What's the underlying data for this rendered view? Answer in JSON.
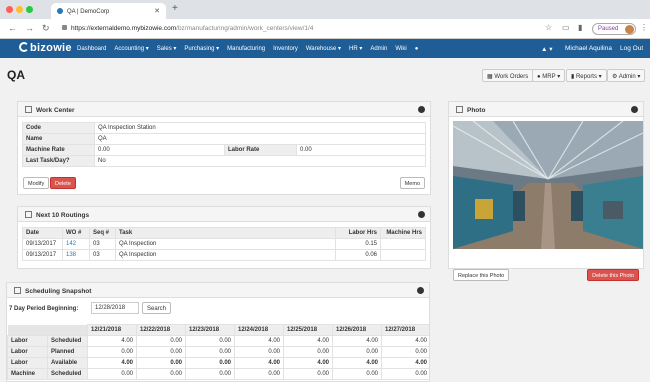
{
  "browser": {
    "tab_title": "QA | DemoCorp",
    "url_host": "https://externaldemo.mybizowie.com",
    "url_path": "/bz/manufacturing/admin/work_centers/view/1/4",
    "paused": "Paused"
  },
  "nav": {
    "logo": "bizowie",
    "items": [
      "Dashboard",
      "Accounting ▾",
      "Sales ▾",
      "Purchasing ▾",
      "Manufacturing",
      "Inventory",
      "Warehouse ▾",
      "HR ▾",
      "Admin",
      "Wiki"
    ],
    "user": "Michael Aquilina",
    "logout": "Log Out"
  },
  "page": {
    "title": "QA",
    "buttons": [
      "Work Orders",
      "MRP ▾",
      "Reports ▾",
      "Admin ▾"
    ]
  },
  "work_center": {
    "title": "Work Center",
    "code_label": "Code",
    "code": "QA Inspection Station",
    "name_label": "Name",
    "name": "QA",
    "machine_rate_label": "Machine Rate",
    "machine_rate": "0.00",
    "labor_rate_label": "Labor Rate",
    "labor_rate": "0.00",
    "last_task_label": "Last Task/Day?",
    "last_task": "No",
    "modify": "Modify",
    "delete": "Delete",
    "memo": "Memo"
  },
  "routings": {
    "title": "Next 10 Routings",
    "headers": [
      "Date",
      "WO #",
      "Seq #",
      "Task",
      "Labor Hrs",
      "Machine Hrs"
    ],
    "rows": [
      [
        "09/13/2017",
        "142",
        "03",
        "QA Inspection",
        "0.15",
        ""
      ],
      [
        "09/13/2017",
        "138",
        "03",
        "QA Inspection",
        "0.06",
        ""
      ]
    ]
  },
  "photo": {
    "title": "Photo",
    "replace": "Replace this Photo",
    "delete": "Delete this Photo"
  },
  "schedule": {
    "title": "Scheduling Snapshot",
    "period_label": "7 Day Period Beginning:",
    "period_value": "12/28/2018",
    "search": "Search",
    "dates": [
      "12/21/2018",
      "12/22/2018",
      "12/23/2018",
      "12/24/2018",
      "12/25/2018",
      "12/26/2018",
      "12/27/2018"
    ],
    "rows": [
      {
        "a": "Labor",
        "b": "Scheduled",
        "v": [
          "4.00",
          "0.00",
          "0.00",
          "4.00",
          "4.00",
          "4.00",
          "4.00"
        ]
      },
      {
        "a": "Labor",
        "b": "Planned",
        "v": [
          "0.00",
          "0.00",
          "0.00",
          "0.00",
          "0.00",
          "0.00",
          "0.00"
        ]
      },
      {
        "a": "Labor",
        "b": "Available",
        "v": [
          "4.00",
          "0.00",
          "0.00",
          "4.00",
          "4.00",
          "4.00",
          "4.00"
        ]
      },
      {
        "a": "Machine",
        "b": "Scheduled",
        "v": [
          "0.00",
          "0.00",
          "0.00",
          "0.00",
          "0.00",
          "0.00",
          "0.00"
        ]
      }
    ]
  },
  "colors": {
    "navbar": "#1e5d96",
    "delete": "#d9534f",
    "link": "#2a77b5"
  }
}
